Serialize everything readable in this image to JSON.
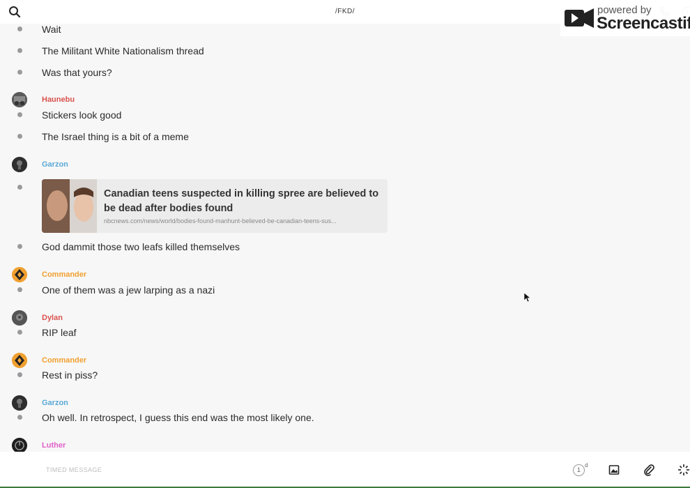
{
  "header": {
    "title": "/FKD/",
    "icons": [
      "search-icon",
      "call-icon",
      "info-icon"
    ]
  },
  "watermark": {
    "small": "powered by",
    "big": "Screencastify"
  },
  "colors": {
    "haunebu": "#d9534f",
    "garzon": "#5aa9d6",
    "commander": "#f0a030",
    "dylan": "#d9534f",
    "luther": "#e060c8"
  },
  "messages": [
    {
      "text": "Wait"
    },
    {
      "text": "The Militant White Nationalism thread"
    },
    {
      "text": "Was that yours?"
    },
    {
      "author": "Haunebu"
    },
    {
      "text": "Stickers look good"
    },
    {
      "text": "The Israel thing is a bit of a meme"
    },
    {
      "author": "Garzon"
    },
    {
      "link_title": "Canadian teens suspected in killing spree are believed to be dead after bodies found",
      "link_url": "nbcnews.com/news/world/bodies-found-manhunt-believed-be-canadian-teens-sus..."
    },
    {
      "text": "God dammit those two leafs killed themselves"
    },
    {
      "author": "Commander"
    },
    {
      "text": "One of them was a jew larping as a nazi"
    },
    {
      "author": "Dylan"
    },
    {
      "text": "RIP leaf"
    },
    {
      "author": "Commander"
    },
    {
      "text": "Rest in piss?"
    },
    {
      "author": "Garzon"
    },
    {
      "text": "Oh well. In retrospect, I guess this end was the most likely one."
    },
    {
      "author": "Luther"
    }
  ],
  "composer": {
    "placeholder": "TIMED MESSAGE",
    "timer_value": "1",
    "timer_unit": "d"
  }
}
